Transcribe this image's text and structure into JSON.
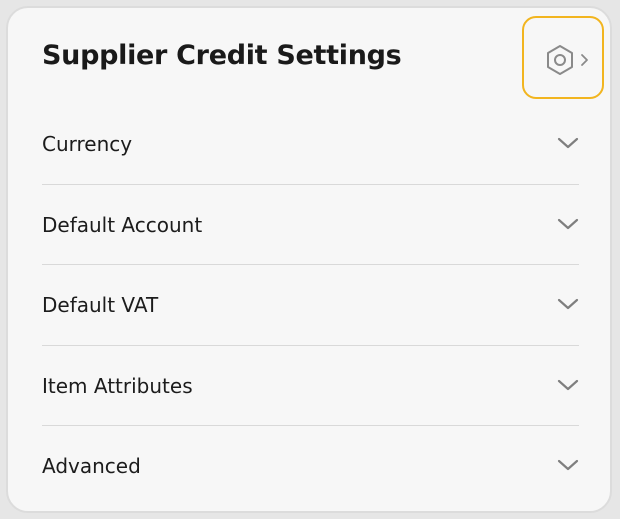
{
  "panel": {
    "title": "Supplier Credit Settings",
    "settings_icon": "hex-nut-gear-icon",
    "accent_color": "#f2b51f"
  },
  "sections": [
    {
      "label": "Currency",
      "icon": "chevron-down-icon"
    },
    {
      "label": "Default Account",
      "icon": "chevron-down-icon"
    },
    {
      "label": "Default VAT",
      "icon": "chevron-down-icon"
    },
    {
      "label": "Item Attributes",
      "icon": "chevron-down-icon"
    },
    {
      "label": "Advanced",
      "icon": "chevron-down-icon"
    }
  ]
}
